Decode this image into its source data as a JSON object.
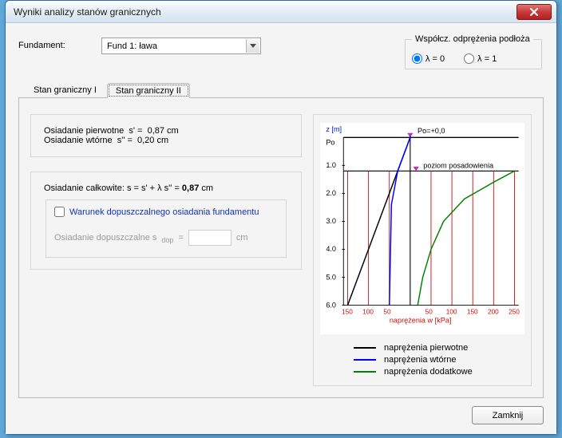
{
  "window": {
    "title": "Wyniki analizy stanów granicznych"
  },
  "fundament": {
    "label": "Fundament:",
    "selected": "Fund 1: ława"
  },
  "relief": {
    "legend": "Współcz. odprężenia podłoża",
    "opt0": "λ = 0",
    "opt1": "λ = 1",
    "selected": 0
  },
  "tabs": {
    "t1": "Stan graniczny I",
    "t2": "Stan graniczny II"
  },
  "panel_settle": {
    "line1": "Osiadanie pierwotne  s' =  0,87 cm",
    "line2": "Osiadanie wtórne  s'' =  0,20 cm"
  },
  "panel_total": {
    "prefix": "Osiadanie całkowite:  s = s' + λ s'' = ",
    "value": "0,87",
    "unit": " cm"
  },
  "group_allow": {
    "chk_label": "Warunek dopuszczalnego osiadania fundamentu",
    "row_label": "Osiadanie dopuszczalne   s",
    "row_sub": "dop",
    "row_eq": "=",
    "unit": "cm",
    "value": ""
  },
  "chart_labels": {
    "y_title": "z [m]",
    "po_marker": "Po=+0,0",
    "po_axis": "Po",
    "level_label": "poziom posadowienia",
    "x_title": "naprężenia w [kPa]"
  },
  "legend": {
    "l1": "naprężenia pierwotne",
    "l2": "naprężenia wtórne",
    "l3": "naprężenia dodatkowe"
  },
  "buttons": {
    "close": "Zamknij"
  },
  "chart_data": {
    "type": "line",
    "y_label": "z [m]",
    "y_ticks": [
      0,
      1.0,
      2.0,
      3.0,
      4.0,
      5.0,
      6.0
    ],
    "x_label": "naprężenia w [kPa]",
    "x_ticks_left": [
      150,
      100,
      50
    ],
    "x_ticks_right": [
      50,
      100,
      150,
      200,
      250
    ],
    "foundation_level_z": 1.2,
    "po_z": 0.0,
    "grid_vertical_kpa": [
      -150,
      -100,
      -50,
      50,
      100,
      150,
      200,
      250
    ],
    "series": [
      {
        "name": "naprężenia pierwotne",
        "color": "#000000",
        "points": [
          {
            "z": 0.0,
            "kpa": 0
          },
          {
            "z": 6.0,
            "kpa": -150
          }
        ]
      },
      {
        "name": "naprężenia wtórne",
        "color": "#0000ff",
        "points": [
          {
            "z": 0.0,
            "kpa": 0
          },
          {
            "z": 1.2,
            "kpa": -30
          },
          {
            "z": 2.4,
            "kpa": -45
          },
          {
            "z": 6.0,
            "kpa": -50
          }
        ]
      },
      {
        "name": "naprężenia dodatkowe",
        "color": "#008000",
        "points": [
          {
            "z": 1.2,
            "kpa": 250
          },
          {
            "z": 1.6,
            "kpa": 200
          },
          {
            "z": 2.2,
            "kpa": 130
          },
          {
            "z": 3.0,
            "kpa": 80
          },
          {
            "z": 4.0,
            "kpa": 50
          },
          {
            "z": 5.0,
            "kpa": 30
          },
          {
            "z": 6.0,
            "kpa": 18
          }
        ]
      }
    ]
  }
}
